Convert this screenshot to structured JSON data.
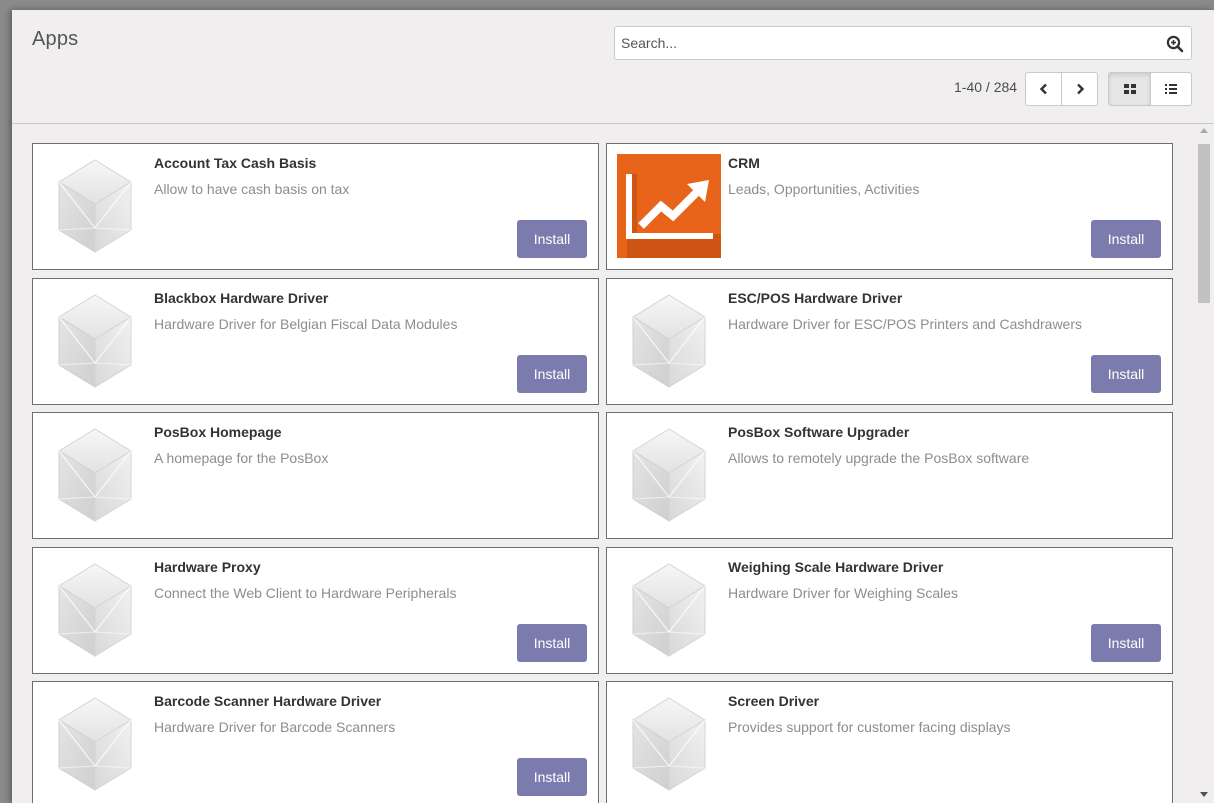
{
  "page": {
    "title": "Apps"
  },
  "search": {
    "placeholder": "Search..."
  },
  "pager": {
    "value": "1-40 / 284"
  },
  "colors": {
    "install_button": "#7c7bad",
    "crm_icon": "#e8641b"
  },
  "apps": [
    {
      "name": "Account Tax Cash Basis",
      "summary": "Allow to have cash basis on tax",
      "icon": "cube-icon",
      "button": "Install"
    },
    {
      "name": "CRM",
      "summary": "Leads, Opportunities, Activities",
      "icon": "crm-chart-icon",
      "button": "Install"
    },
    {
      "name": "Blackbox Hardware Driver",
      "summary": "Hardware Driver for Belgian Fiscal Data Modules",
      "icon": "cube-icon",
      "button": "Install"
    },
    {
      "name": "ESC/POS Hardware Driver",
      "summary": "Hardware Driver for ESC/POS Printers and Cashdrawers",
      "icon": "cube-icon",
      "button": "Install"
    },
    {
      "name": "PosBox Homepage",
      "summary": "A homepage for the PosBox",
      "icon": "cube-icon",
      "button": ""
    },
    {
      "name": "PosBox Software Upgrader",
      "summary": "Allows to remotely upgrade the PosBox software",
      "icon": "cube-icon",
      "button": ""
    },
    {
      "name": "Hardware Proxy",
      "summary": "Connect the Web Client to Hardware Peripherals",
      "icon": "cube-icon",
      "button": "Install"
    },
    {
      "name": "Weighing Scale Hardware Driver",
      "summary": "Hardware Driver for Weighing Scales",
      "icon": "cube-icon",
      "button": "Install"
    },
    {
      "name": "Barcode Scanner Hardware Driver",
      "summary": "Hardware Driver for Barcode Scanners",
      "icon": "cube-icon",
      "button": "Install"
    },
    {
      "name": "Screen Driver",
      "summary": "Provides support for customer facing displays",
      "icon": "cube-icon",
      "button": ""
    }
  ]
}
